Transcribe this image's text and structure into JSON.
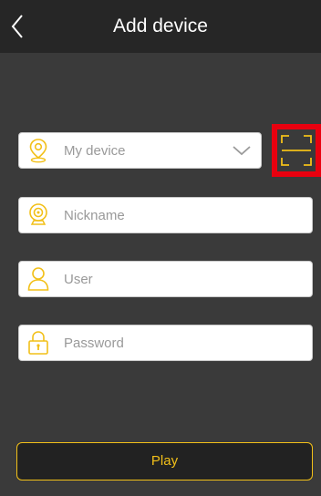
{
  "header": {
    "title": "Add device",
    "back_icon": "chevron-left-icon"
  },
  "form": {
    "device_select": {
      "value": "My device",
      "icon": "location-pin-icon",
      "dropdown_icon": "chevron-down-icon"
    },
    "scan_button": {
      "icon": "scan-frame-icon"
    },
    "nickname": {
      "placeholder": "Nickname",
      "value": "",
      "icon": "camera-icon"
    },
    "user": {
      "placeholder": "User",
      "value": "",
      "icon": "user-icon"
    },
    "password": {
      "placeholder": "Password",
      "value": "",
      "icon": "lock-icon"
    }
  },
  "play_button": {
    "label": "Play"
  },
  "colors": {
    "background": "#3a3a3a",
    "header": "#262626",
    "accent": "#f2c019",
    "highlight": "#e8000f"
  }
}
